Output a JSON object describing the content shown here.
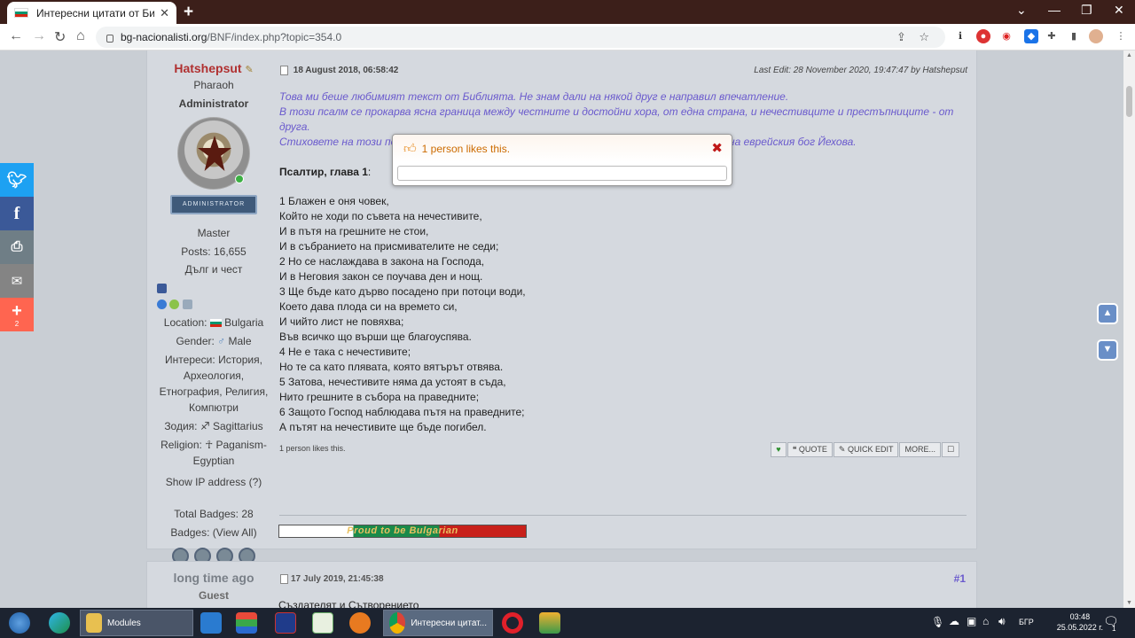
{
  "browser": {
    "tab_title": "Интересни цитати от Библията",
    "tab_close": "✕",
    "new_tab": "+",
    "url_host": "bg-nacionalisti.org",
    "url_path": "/BNF/index.php?topic=354.0",
    "win_min": "⌄",
    "win_minimize": "—",
    "win_restore": "❐",
    "win_close": "✕"
  },
  "post1": {
    "author": "Hatshepsut",
    "position": "Pharaoh",
    "role": "Administrator",
    "rank_label": "Administrator",
    "rank_title": "Master",
    "posts": "Posts: 16,655",
    "motto": "Дълг и чест",
    "location_label": "Location:",
    "location_value": "Bulgaria",
    "gender_label": "Gender:",
    "gender_value": "Male",
    "interests_label": "Интереси:",
    "interests_value": "История, Археология, Етнография, Религия, Компютри",
    "zodiac_label": "Зодия:",
    "zodiac_value": "Sagittarius",
    "religion_label": "Religion:",
    "religion_value": "Paganism-Egyptian",
    "show_ip": "Show IP address",
    "show_ip_help": "(?)",
    "total_badges": "Total Badges: 28",
    "badges_label": "Badges:",
    "badges_view_all": "(View All)",
    "date": "18 August 2018, 06:58:42",
    "last_edit": "Last Edit: 28 November 2020, 19:47:47 by Hatshepsut",
    "intro_lines": [
      "Това ми беше любимият текст от Библията. Не знам дали на някой друг е направил впечатление.",
      "В този псалм се прокарва ясна граница между честните и достойни хора, от една страна, и нечестивците и престъпниците - от друга.",
      "Стиховете на този по",
      "на еврейския бог Йехова."
    ],
    "heading": "Псалтир, глава 1",
    "heading_colon": ":",
    "verses": [
      "1 Блажен е оня човек,",
      "Който не ходи по съвета на нечестивите,",
      "И в пътя на грешните не стои,",
      "И в събранието на присмивателите не седи;",
      "2 Но се наслаждава в закона на Господа,",
      "И в Неговия закон се поучава ден и нощ.",
      "3 Ще бъде като дърво посадено при потоци води,",
      "Което дава плода си на времето си,",
      "И чийто лист не повяхва;",
      "Във всичко що върши ще благоуспява.",
      "4 Не е така с нечестивите;",
      "Но те са като плявата, която вятърът отвява.",
      "5 Затова, нечестивите няма да устоят в съда,",
      "Нито грешните в събора на праведните;",
      "6 Защото Господ наблюдава пътя на праведните;",
      "А пътят на нечестивите ще бъде погибел."
    ],
    "likes_text": "1 person likes this.",
    "actions": {
      "quote": "QUOTE",
      "quick_edit": "QUICK EDIT",
      "more": "MORE..."
    },
    "signature_banner": "Proud to be Bulgarian"
  },
  "post2": {
    "author": "long time ago",
    "role": "Guest",
    "date": "17 July 2019, 21:45:38",
    "number": "#1",
    "first_line": "Създателят и Сътворението"
  },
  "popup": {
    "title": "1 person likes this.",
    "close": "✖"
  },
  "share": {
    "plus_count": "2"
  },
  "taskbar": {
    "modules_label": "Modules",
    "chrome_label": "Интересни цитат...",
    "language": "БГР",
    "time": "03:48",
    "date": "25.05.2022 г.",
    "notif_count": "1"
  },
  "colors": {
    "accent_purple": "#6a5acd",
    "author_red": "#b03030",
    "popup_orange": "#cc6b00"
  }
}
